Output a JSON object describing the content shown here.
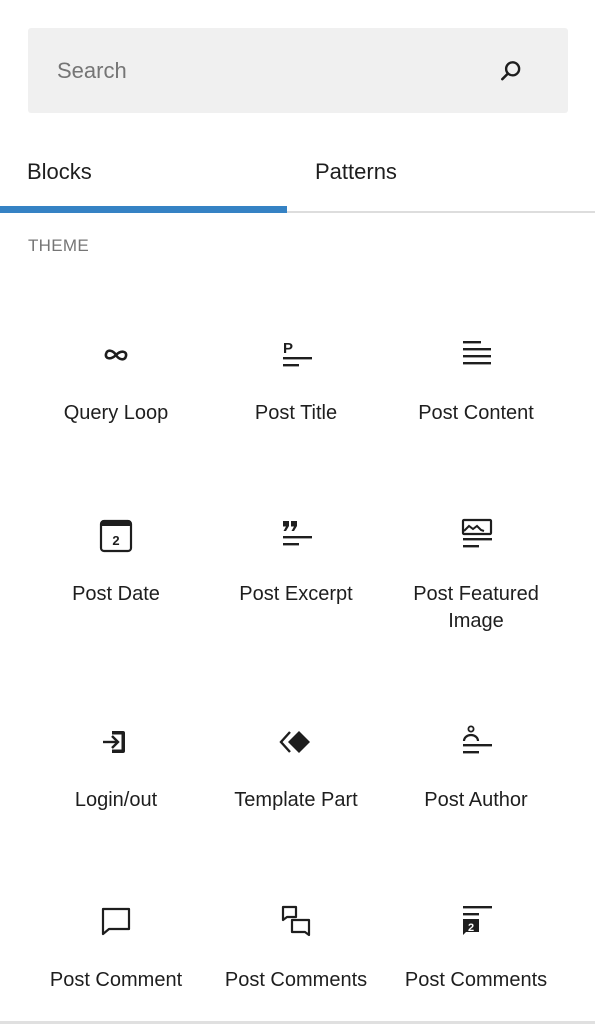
{
  "search": {
    "placeholder": "Search",
    "value": "",
    "icon": "search-icon"
  },
  "tabs": [
    {
      "label": "Blocks",
      "active": true
    },
    {
      "label": "Patterns",
      "active": false
    }
  ],
  "accent_color": "#3582c4",
  "section": {
    "title": "THEME"
  },
  "blocks": [
    {
      "label": "Query Loop",
      "icon": "query-loop-icon"
    },
    {
      "label": "Post Title",
      "icon": "post-title-icon"
    },
    {
      "label": "Post Content",
      "icon": "post-content-icon"
    },
    {
      "label": "Post Date",
      "icon": "post-date-icon"
    },
    {
      "label": "Post Excerpt",
      "icon": "post-excerpt-icon"
    },
    {
      "label": "Post Featured Image",
      "icon": "post-featured-image-icon"
    },
    {
      "label": "Login/out",
      "icon": "login-out-icon"
    },
    {
      "label": "Template Part",
      "icon": "template-part-icon"
    },
    {
      "label": "Post Author",
      "icon": "post-author-icon"
    },
    {
      "label": "Post Comment",
      "icon": "post-comment-icon"
    },
    {
      "label": "Post Comments",
      "icon": "post-comments-icon"
    },
    {
      "label": "Post Comments",
      "icon": "post-comments-count-icon"
    }
  ]
}
